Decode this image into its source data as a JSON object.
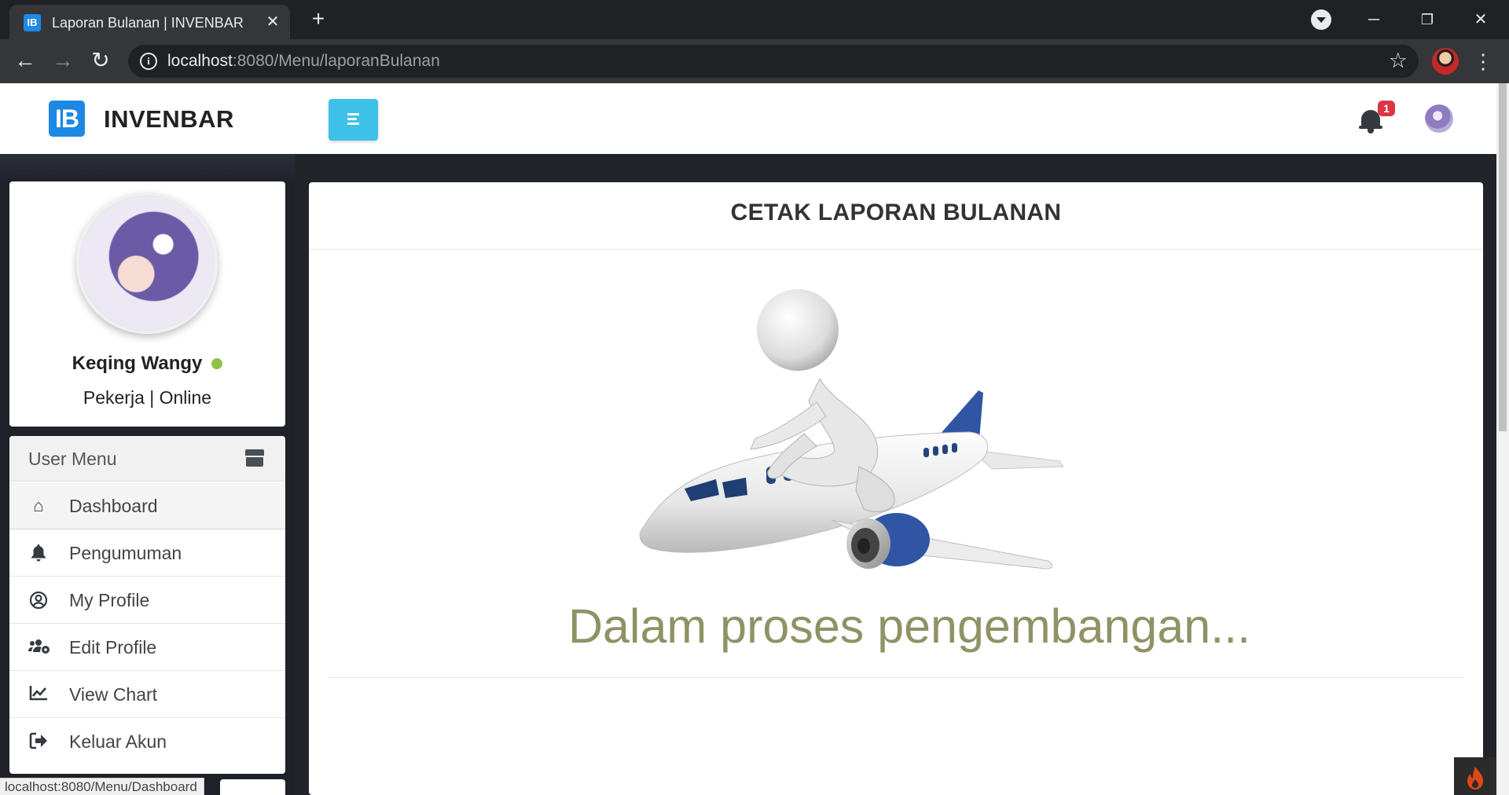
{
  "browser": {
    "tab_title": "Laporan Bulanan | INVENBAR",
    "favicon_text": "IB",
    "url_host": "localhost",
    "url_path": ":8080/Menu/laporanBulanan",
    "status_url": "localhost:8080/Menu/Dashboard"
  },
  "navbar": {
    "logo_text": "IB",
    "brand": "INVENBAR",
    "notification_count": "1",
    "accent_color": "#3ec1e8"
  },
  "profile": {
    "name": "Keqing Wangy",
    "role": "Pekerja | Online",
    "status_color": "#8bc34a"
  },
  "user_menu": {
    "header": "User Menu",
    "items": [
      {
        "label": "Dashboard",
        "icon": "house-user-icon",
        "active": true
      },
      {
        "label": "Pengumuman",
        "icon": "bell-icon",
        "active": false
      },
      {
        "label": "My Profile",
        "icon": "user-circle-icon",
        "active": false
      },
      {
        "label": "Edit Profile",
        "icon": "users-cog-icon",
        "active": false
      },
      {
        "label": "View Chart",
        "icon": "chart-line-icon",
        "active": false
      },
      {
        "label": "Keluar Akun",
        "icon": "sign-out-icon",
        "active": false
      }
    ]
  },
  "main": {
    "title": "CETAK LAPORAN BULANAN",
    "message": "Dalam proses pengembangan...",
    "message_color": "#8f9264"
  }
}
